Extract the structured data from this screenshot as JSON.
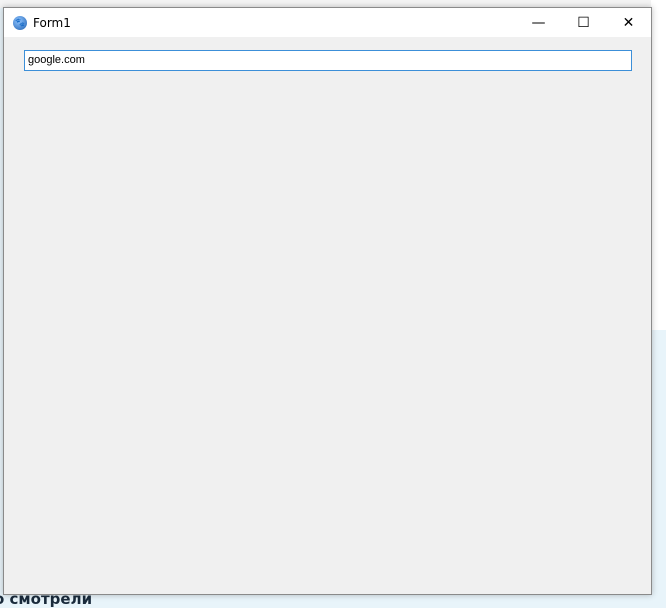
{
  "window": {
    "title": "Form1",
    "app_icon": "paw-icon"
  },
  "controls": {
    "minimize": "—",
    "maximize": "☐",
    "close": "✕"
  },
  "url_input": {
    "value": "google.com"
  },
  "background": {
    "partial_text": "о смотрели"
  }
}
